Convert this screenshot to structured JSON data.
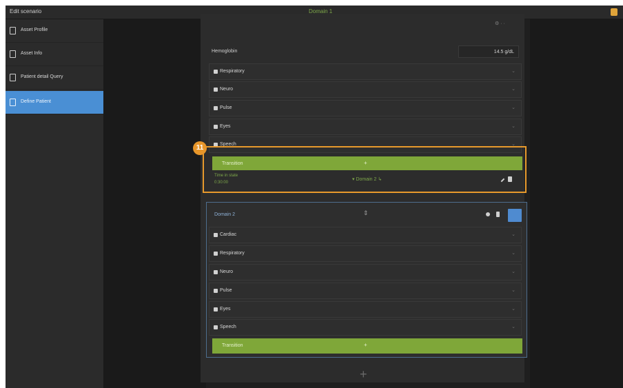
{
  "window": {
    "title": "Edit scenario",
    "center_title": "Domain 1"
  },
  "sidebar": {
    "items": [
      {
        "label": "Asset Profile",
        "icon": "document-icon",
        "active": false
      },
      {
        "label": "Asset Info",
        "icon": "file-icon",
        "active": false
      },
      {
        "label": "Patient detail Query",
        "icon": "person-icon",
        "active": false
      },
      {
        "label": "Define Patient",
        "icon": "scenario-icon",
        "active": true
      }
    ]
  },
  "top_section": {
    "fields": [
      {
        "label": "Hemoglobin",
        "value": "14.5 g/dL"
      }
    ],
    "sections": [
      {
        "label": "Respiratory",
        "icon": "lungs-icon"
      },
      {
        "label": "Neuro",
        "icon": "brain-icon"
      },
      {
        "label": "Pulse",
        "icon": "pulse-icon"
      },
      {
        "label": "Eyes",
        "icon": "eye-icon"
      },
      {
        "label": "Speech",
        "icon": "speech-icon"
      }
    ],
    "transition_bar": {
      "label": "Transition",
      "center": "+"
    },
    "transition_detail": {
      "line1": "Time in state",
      "line2": "0:30:00",
      "target": "▾ Domain 2 ↳"
    }
  },
  "callout": {
    "number": "11"
  },
  "scenario_card": {
    "title": "Domain 2",
    "drag_handle": "⇕",
    "sections": [
      {
        "label": "Cardiac",
        "icon": "heart-icon"
      },
      {
        "label": "Respiratory",
        "icon": "lungs-icon"
      },
      {
        "label": "Neuro",
        "icon": "brain-icon"
      },
      {
        "label": "Pulse",
        "icon": "pulse-icon"
      },
      {
        "label": "Eyes",
        "icon": "eye-icon"
      },
      {
        "label": "Speech",
        "icon": "speech-icon"
      }
    ],
    "transition_bar": {
      "label": "Transition",
      "center": "+"
    }
  },
  "add_button": {
    "label": "+"
  },
  "top_icons": "⚙ ·  ·",
  "colors": {
    "accent_green": "#7fa739",
    "accent_blue": "#4a8fd4",
    "callout_orange": "#e89a2c"
  }
}
